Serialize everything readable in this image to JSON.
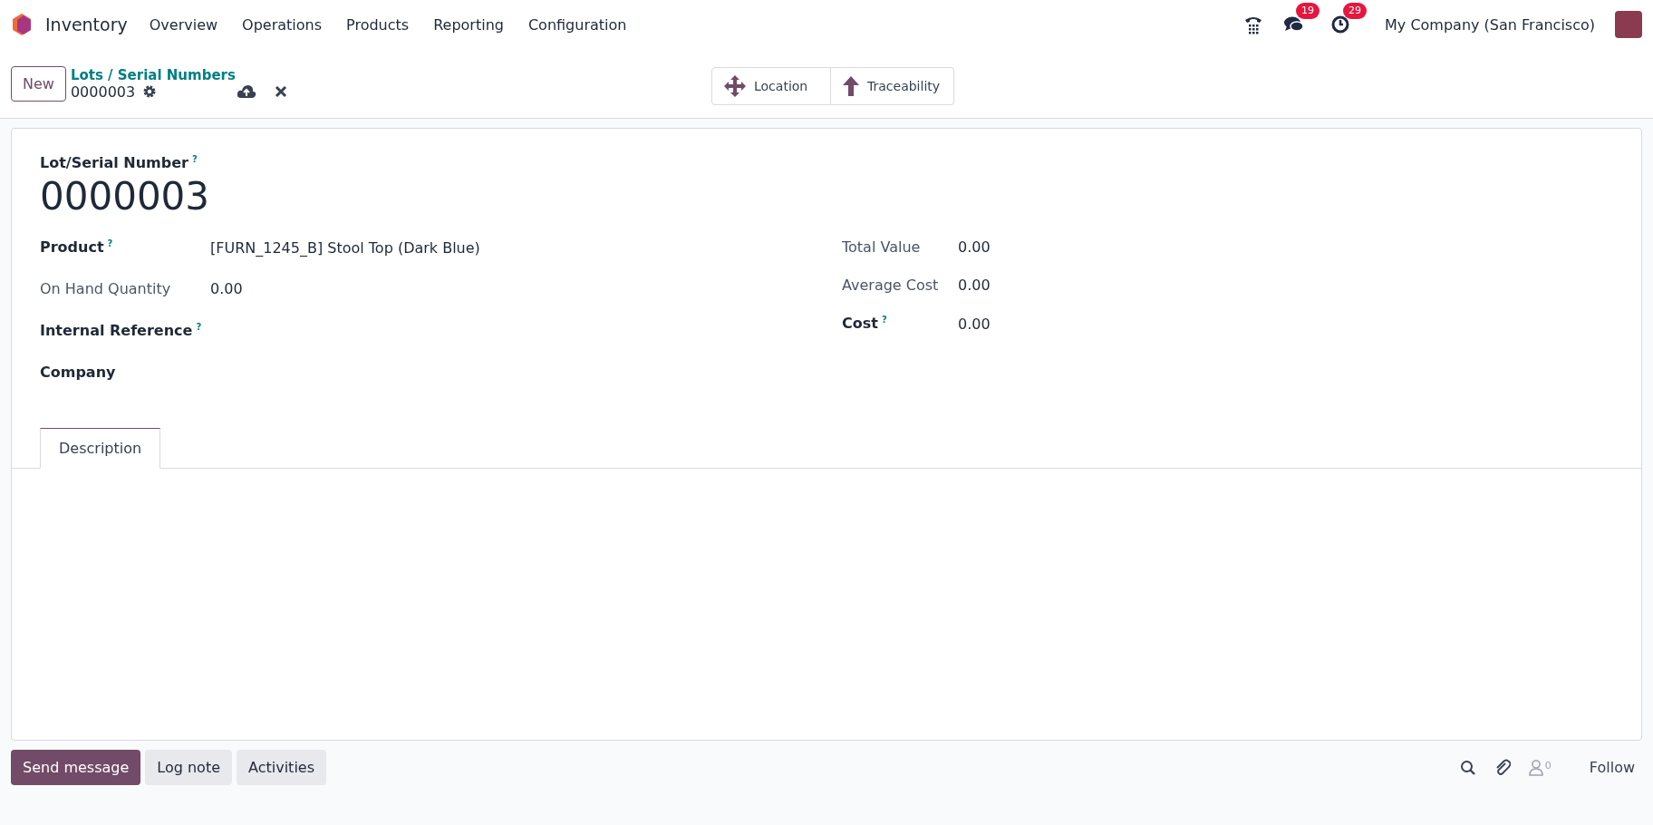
{
  "navbar": {
    "app_name": "Inventory",
    "menu": [
      "Overview",
      "Operations",
      "Products",
      "Reporting",
      "Configuration"
    ],
    "messages_badge": "19",
    "activities_badge": "29",
    "company": "My Company (San Francisco)"
  },
  "control_panel": {
    "new_button": "New",
    "breadcrumb": "Lots / Serial Numbers",
    "record_name": "0000003",
    "smart_buttons": [
      {
        "kind": "location",
        "label": "Location"
      },
      {
        "kind": "traceability",
        "label": "Traceability"
      }
    ]
  },
  "form": {
    "title_label": "Lot/Serial Number",
    "title_help": "?",
    "title": "0000003",
    "left_fields": [
      {
        "label": "Product",
        "help": "?",
        "value": "[FURN_1245_B] Stool Top (Dark Blue)",
        "readonly": false
      },
      {
        "label": "On Hand Quantity",
        "value": "0.00",
        "readonly": true
      },
      {
        "label": "Internal Reference",
        "help": "?",
        "readonly": false
      },
      {
        "label": "Company",
        "readonly": false
      }
    ],
    "right_fields": [
      {
        "label": "Total Value",
        "value": "0.00",
        "readonly": true
      },
      {
        "label": "Average Cost",
        "value": "0.00",
        "readonly": true
      },
      {
        "label": "Cost",
        "help": "?",
        "value": "0.00",
        "readonly": false
      }
    ],
    "tabs": [
      {
        "label": "Description",
        "selected": true
      }
    ]
  },
  "chatter": {
    "buttons": [
      {
        "label": "Send message",
        "selected": true
      },
      {
        "label": "Log note",
        "selected": false
      },
      {
        "label": "Activities",
        "selected": false
      }
    ],
    "followers_count": "0",
    "follow": "Follow"
  }
}
